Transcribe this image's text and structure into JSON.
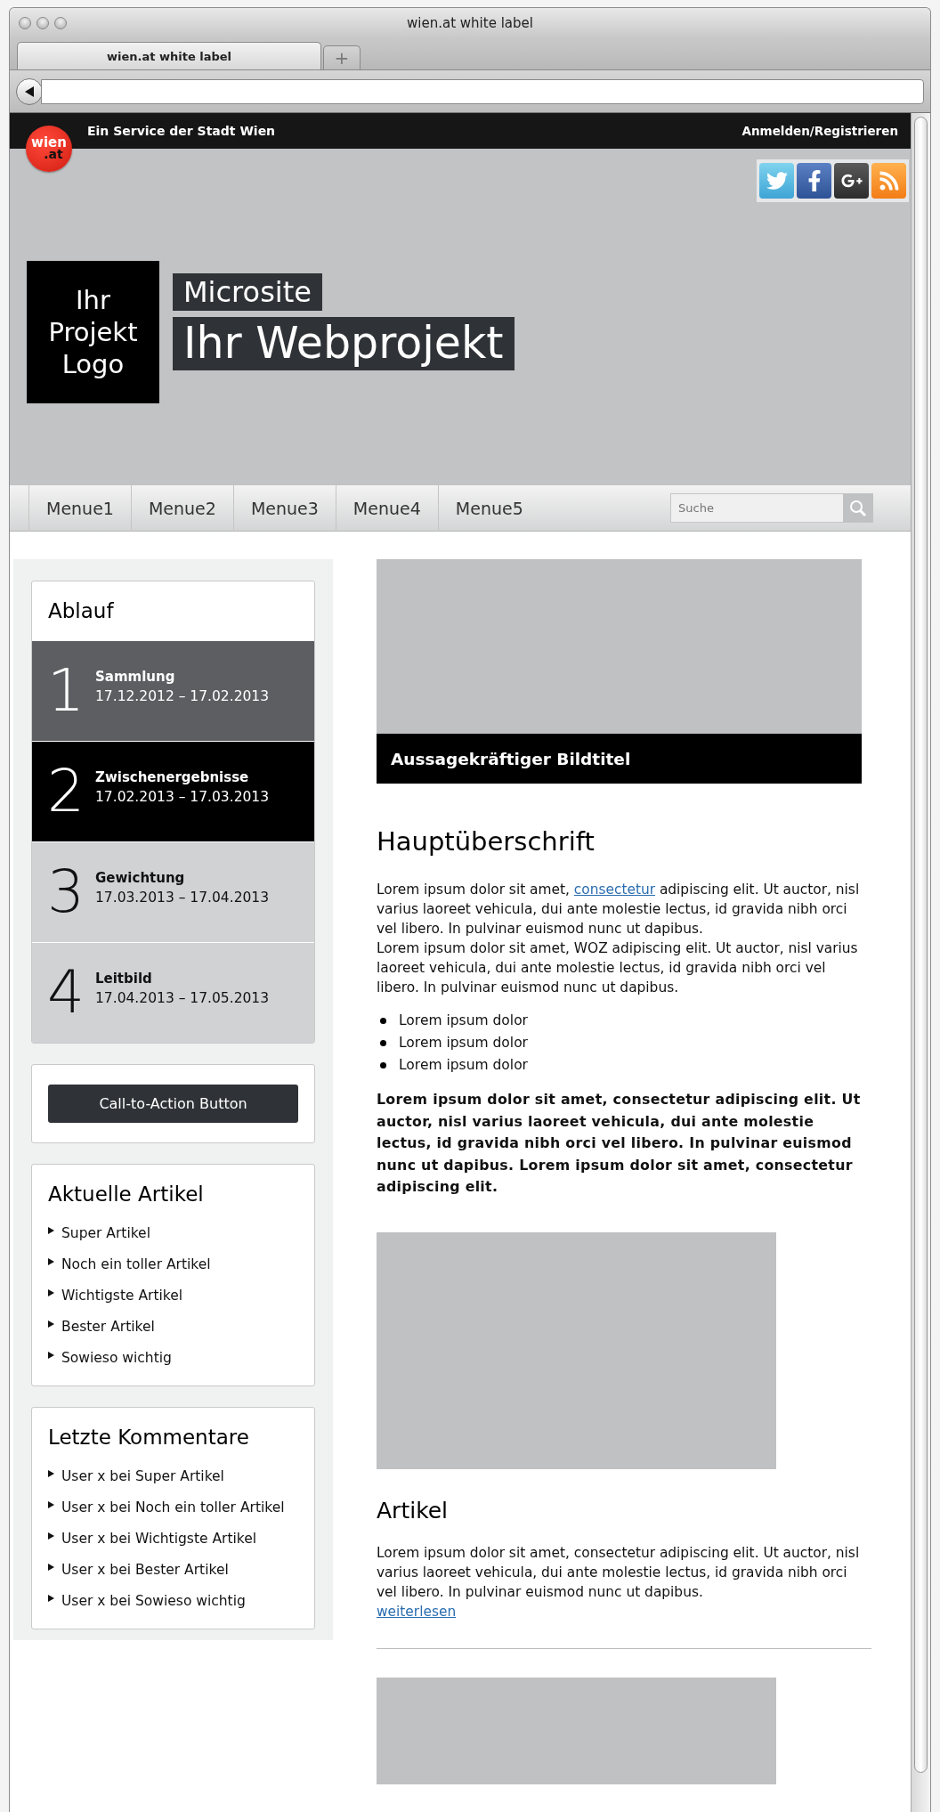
{
  "browser": {
    "title": "wien.at white label",
    "tabs": [
      {
        "label": "wien.at white label",
        "selected": true
      }
    ],
    "new_tab": "+"
  },
  "topbar": {
    "logo": {
      "word": "wien",
      "suffix": ".at"
    },
    "service": "Ein Service der Stadt Wien",
    "login": "Anmelden/Registrieren"
  },
  "header": {
    "logo_box": "Ihr Projekt Logo",
    "kicker": "Microsite",
    "title": "Ihr Webprojekt",
    "social": [
      {
        "kind": "twitter"
      },
      {
        "kind": "facebook"
      },
      {
        "kind": "googleplus"
      },
      {
        "kind": "rss"
      }
    ]
  },
  "nav": {
    "items": [
      "Menue1",
      "Menue2",
      "Menue3",
      "Menue4",
      "Menue5"
    ],
    "search": {
      "placeholder": "Suche"
    }
  },
  "sidebar": {
    "ablauf": {
      "title": "Ablauf",
      "steps": [
        {
          "number": "1",
          "name": "Sammlung",
          "dates": "17.12.2012 – 17.02.2013",
          "kind": "past"
        },
        {
          "number": "2",
          "name": "Zwischenergebnisse",
          "dates": "17.02.2013 – 17.03.2013",
          "kind": "current"
        },
        {
          "number": "3",
          "name": "Gewichtung",
          "dates": "17.03.2013 – 17.04.2013",
          "kind": "upcoming"
        },
        {
          "number": "4",
          "name": "Leitbild",
          "dates": "17.04.2013 – 17.05.2013",
          "kind": "upcoming"
        }
      ]
    },
    "cta": "Call-to-Action Button",
    "articles": {
      "title": "Aktuelle Artikel",
      "items": [
        "Super Artikel",
        "Noch ein toller Artikel",
        "Wichtigste Artikel",
        "Bester Artikel",
        "Sowieso wichtig"
      ]
    },
    "comments": {
      "title": "Letzte Kommentare",
      "items": [
        "User x bei Super Artikel",
        "User x bei Noch ein toller Artikel",
        "User x bei Wichtigste Artikel",
        "User x bei Bester Artikel",
        "User x bei Sowieso wichtig"
      ]
    }
  },
  "main": {
    "hero": {
      "caption": "Aussagekräftiger Bildtitel"
    },
    "heading": "Hauptüberschrift",
    "intro": {
      "before": "Lorem ipsum dolor sit amet, ",
      "link": "consectetur",
      "after": " adipiscing elit. Ut auctor, nisl varius laoreet vehicula, dui ante molestie lectus, id gravida nibh orci vel libero. In pulvinar euismod nunc ut dapibus."
    },
    "paragraph": "Lorem ipsum dolor sit amet, WOZ adipiscing elit. Ut auctor, nisl varius laoreet vehicula, dui ante molestie lectus, id gravida nibh orci vel libero. In pulvinar euismod nunc ut dapibus.",
    "bullets": [
      "Lorem ipsum dolor",
      "Lorem ipsum dolor",
      "Lorem ipsum dolor"
    ],
    "bold_paragraph": "Lorem ipsum dolor sit amet, consectetur adipiscing elit. Ut auctor, nisl varius laoreet vehicula, dui ante molestie lectus, id gravida nibh orci vel libero. In pulvinar euismod nunc ut dapibus. Lorem ipsum dolor sit amet, consectetur adipiscing elit.",
    "article": {
      "title": "Artikel",
      "text": "Lorem ipsum dolor sit amet, consectetur adipiscing elit. Ut auctor, nisl varius laoreet vehicula, dui ante molestie lectus, id gravida nibh orci vel libero. In pulvinar euismod nunc ut dapibus.",
      "more": "weiterlesen"
    }
  }
}
